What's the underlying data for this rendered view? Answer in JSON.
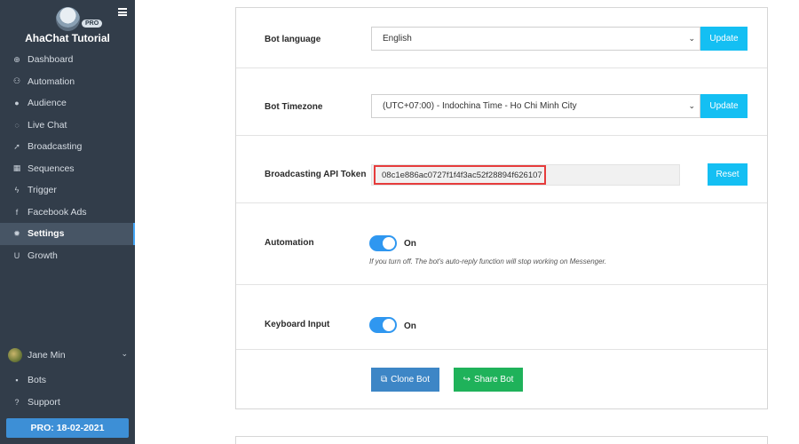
{
  "sidebar": {
    "brand_badge": "PRO",
    "brand_name": "AhaChat Tutorial",
    "items": [
      {
        "label": "Dashboard",
        "icon": "⊕"
      },
      {
        "label": "Automation",
        "icon": "⚇"
      },
      {
        "label": "Audience",
        "icon": "●"
      },
      {
        "label": "Live Chat",
        "icon": "◌"
      },
      {
        "label": "Broadcasting",
        "icon": "➚"
      },
      {
        "label": "Sequences",
        "icon": "▦"
      },
      {
        "label": "Trigger",
        "icon": "ϟ"
      },
      {
        "label": "Facebook Ads",
        "icon": "f"
      },
      {
        "label": "Settings",
        "icon": "✹"
      },
      {
        "label": "Growth",
        "icon": "U"
      }
    ],
    "user_name": "Jane Min",
    "bottom_items": [
      {
        "label": "Bots",
        "icon": "▪"
      },
      {
        "label": "Support",
        "icon": "?"
      }
    ],
    "pro_expiry": "PRO: 18-02-2021"
  },
  "settings": {
    "bot_language": {
      "label": "Bot language",
      "value": "English",
      "button": "Update"
    },
    "bot_timezone": {
      "label": "Bot Timezone",
      "value": "(UTC+07:00) - Indochina Time - Ho Chi Minh City",
      "button": "Update"
    },
    "api_token": {
      "label": "Broadcasting API Token",
      "value": "08c1e886ac0727f1f4f3ac52f28894f626107",
      "button": "Reset"
    },
    "automation": {
      "label": "Automation",
      "state": "On",
      "note": "If you turn off. The bot's auto-reply function will stop working on Messenger."
    },
    "keyboard_input": {
      "label": "Keyboard Input",
      "state": "On"
    },
    "clone_bot": "Clone Bot",
    "share_bot": "Share Bot"
  },
  "colors": {
    "sidebar_bg": "#323d4a",
    "accent": "#14bff3",
    "toggle": "#2f97f0",
    "clone": "#3d86c6",
    "share": "#1fb25a",
    "highlight": "#e63c3c"
  }
}
